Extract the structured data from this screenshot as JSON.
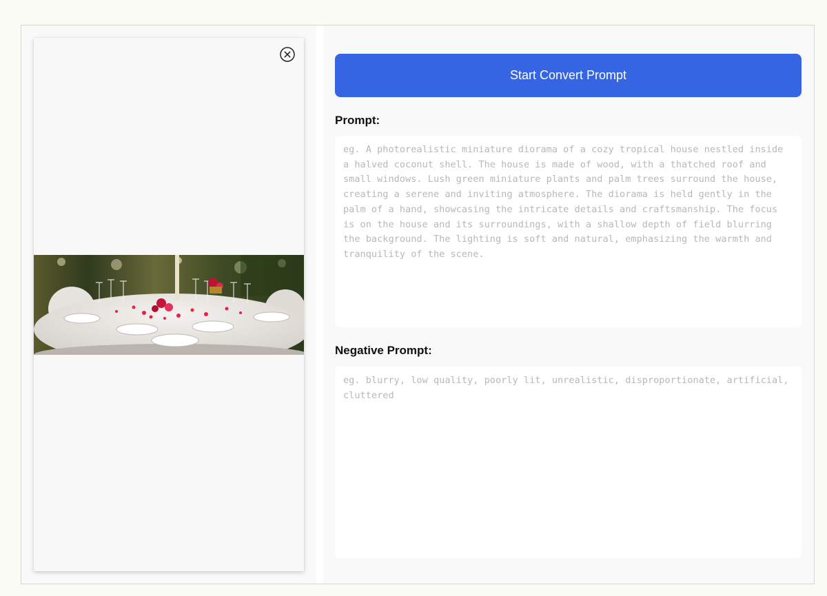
{
  "image_panel": {
    "close_icon": "close-circle-icon",
    "image_subject": "banquet-table-photo"
  },
  "actions": {
    "convert_label": "Start Convert Prompt",
    "accent_color": "#3665e3"
  },
  "prompt": {
    "label": "Prompt:",
    "value": "",
    "placeholder": "eg. A photorealistic miniature diorama of a cozy tropical house nestled inside a halved coconut shell. The house is made of wood, with a thatched roof and small windows. Lush green miniature plants and palm trees surround the house, creating a serene and inviting atmosphere. The diorama is held gently in the palm of a hand, showcasing the intricate details and craftsmanship. The focus is on the house and its surroundings, with a shallow depth of field blurring the background. The lighting is soft and natural, emphasizing the warmth and tranquility of the scene."
  },
  "negative_prompt": {
    "label": "Negative Prompt:",
    "value": "",
    "placeholder": "eg. blurry, low quality, poorly lit, unrealistic, disproportionate, artificial, cluttered"
  }
}
